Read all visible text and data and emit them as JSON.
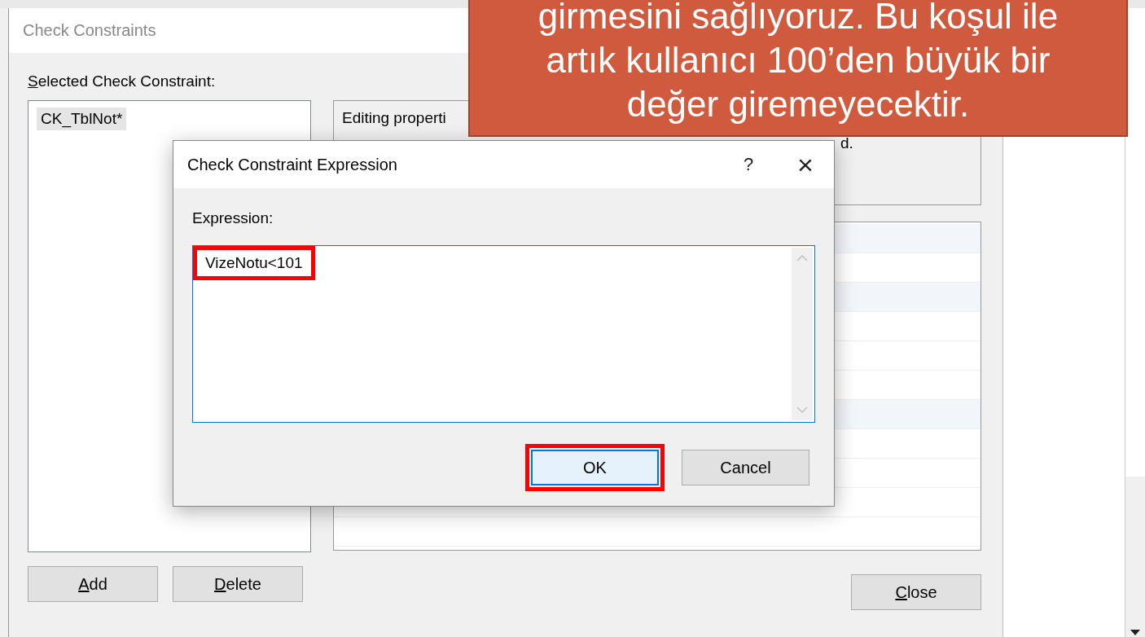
{
  "main_dialog": {
    "title": "Check Constraints",
    "active": false,
    "selected_label": {
      "text": "Selected Check Constraint:",
      "access_key": true
    },
    "constraints": [
      {
        "name": "CK_TblNot*",
        "selected": true
      }
    ],
    "description": [
      "Editing properti",
      "d."
    ],
    "buttons": [
      {
        "label": "Add",
        "access_key": true,
        "kind": "left"
      },
      {
        "label": "Delete",
        "access_key": true,
        "kind": "left"
      },
      {
        "label": "Close",
        "access_key": true,
        "kind": "right"
      }
    ]
  },
  "expression_dialog": {
    "title": "Check Constraint Expression",
    "help": "?",
    "close": "×",
    "label": "Expression:",
    "value": "VizeNotu<101",
    "value_highlighted": true,
    "buttons": [
      {
        "label": "OK",
        "default": true,
        "highlighted": true
      },
      {
        "label": "Cancel",
        "default": false,
        "highlighted": false
      }
    ]
  },
  "callout": {
    "text": "girmesini sağlıyoruz. Bu koşul ile artık kullanıcı 100’den büyük bir değer giremeyecektir."
  }
}
